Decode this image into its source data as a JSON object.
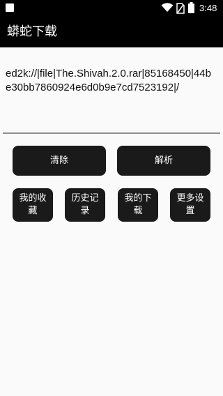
{
  "status_bar": {
    "time": "3:48",
    "icons": [
      "notification-square-icon",
      "wifi-icon",
      "no-sim-icon",
      "battery-icon"
    ]
  },
  "app_bar": {
    "title": "蟒蛇下载"
  },
  "link_input": {
    "value": "ed2k://|file|The.Shivah.2.0.rar|85168450|44be30bb7860924e6d0b9e7cd7523192|/"
  },
  "buttons": {
    "clear": "清除",
    "parse": "解析",
    "favorites": "我的收藏",
    "history": "历史记录",
    "downloads": "我的下载",
    "settings": "更多设置"
  },
  "colors": {
    "app_bar_bg": "#000000",
    "button_bg": "#1a1a1a",
    "page_bg": "#fafafa"
  }
}
